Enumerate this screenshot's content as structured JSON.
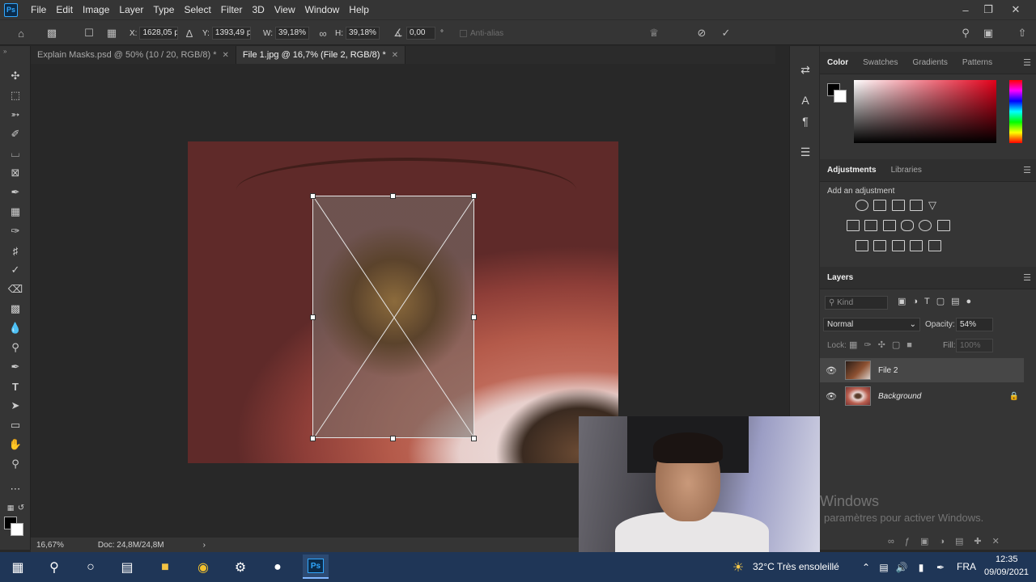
{
  "app": {
    "logo": "Ps"
  },
  "menu": [
    "File",
    "Edit",
    "Image",
    "Layer",
    "Type",
    "Select",
    "Filter",
    "3D",
    "View",
    "Window",
    "Help"
  ],
  "options": {
    "x_label": "X:",
    "x_value": "1628,05 p",
    "y_label": "Y:",
    "y_value": "1393,49 p",
    "w_label": "W:",
    "w_value": "39,18%",
    "h_label": "H:",
    "h_value": "39,18%",
    "angle_value": "0,00",
    "angle_unit": "°",
    "antialias": "Anti-alias"
  },
  "tabs": [
    {
      "label": "Explain Masks.psd @ 50% (10 / 20, RGB/8) *",
      "active": false
    },
    {
      "label": "File 1.jpg @ 16,7% (File 2, RGB/8) *",
      "active": true
    }
  ],
  "status": {
    "zoom": "16,67%",
    "doc": "Doc: 24,8M/24,8M"
  },
  "color_panel": {
    "tabs": [
      "Color",
      "Swatches",
      "Gradients",
      "Patterns"
    ]
  },
  "adjustments_panel": {
    "tabs": [
      "Adjustments",
      "Libraries"
    ],
    "hint": "Add an adjustment"
  },
  "layers_panel": {
    "title": "Layers",
    "filter_placeholder": "Kind",
    "blend_mode": "Normal",
    "opacity_label": "Opacity:",
    "opacity_value": "54%",
    "lock_label": "Lock:",
    "fill_label": "Fill:",
    "fill_value": "100%",
    "layers": [
      {
        "name": "File 2",
        "selected": true
      },
      {
        "name": "Background",
        "selected": false
      }
    ]
  },
  "watermark": {
    "title": "Windows",
    "subtitle": "paramètres pour activer Windows."
  },
  "taskbar": {
    "weather": "32°C  Très ensoleillé",
    "lang": "FRA",
    "time": "12:35",
    "date": "09/09/2021"
  }
}
